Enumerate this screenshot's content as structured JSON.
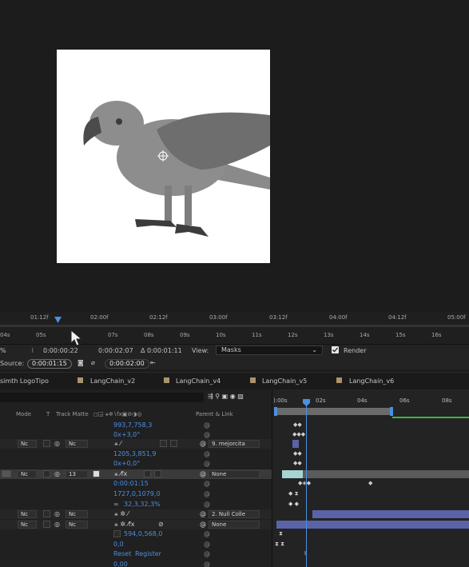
{
  "ruler": {
    "top_ticks": [
      "01:12f",
      "02:00f",
      "02:12f",
      "03:00f",
      "03:12f",
      "04:00f",
      "04:12f",
      "05:00f"
    ],
    "bottom_ticks": [
      "04s",
      "05s",
      "07s",
      "08s",
      "09s",
      "10s",
      "11s",
      "12s",
      "13s",
      "14s",
      "15s",
      "16s"
    ]
  },
  "footbar": {
    "percent_fragment": "%",
    "current_time": "0:00:00:22",
    "duration": "0:00:02:07",
    "delta": "Δ 0:00:01:11",
    "view_label": "View:",
    "view_value": "Masks",
    "render_label": "Render",
    "source_label": "Source:",
    "source_time": "0:00:01:15",
    "source_end": "0:00:02:00"
  },
  "tabs": [
    "simth LogoTipo",
    "LangChain_v2",
    "LangChain_v4",
    "LangChain_v5",
    "LangChain_v6"
  ],
  "columns": {
    "mode": "Mode",
    "t": "T",
    "track_matte": "Track Matte",
    "parent": "Parent & Link"
  },
  "timeline_labels": [
    "):00s",
    "02s",
    "04s",
    "06s",
    "08s"
  ],
  "rows": [
    {
      "value": "993,7,758,3"
    },
    {
      "value": "0x+3,0°"
    },
    {
      "mode": "Nc",
      "matte": "Nc",
      "parent": "9. mejorcita"
    },
    {
      "value": "1205,3,851,9"
    },
    {
      "value": "0x+0,0°"
    },
    {
      "mode": "Nc",
      "matte": "13",
      "parent": "None"
    },
    {
      "value": "0:00:01:15"
    },
    {
      "value": "1727,0,1079,0"
    },
    {
      "value": "32,3,32,3%"
    },
    {
      "mode": "Nc",
      "matte": "Nc",
      "parent": "2. Null Colle"
    },
    {
      "mode": "Nc",
      "matte": "Nc",
      "parent": "None"
    },
    {
      "value": "594,0,568,0"
    },
    {
      "value": "0,0"
    },
    {
      "reset": "Reset",
      "register": "Register"
    },
    {
      "value": "0,00"
    }
  ],
  "colors": {
    "accent": "#4a90e2",
    "label_tan": "#a9946c",
    "workarea_green": "#39b54a",
    "layer_bar_blue": "#5a63a8"
  },
  "icons": [
    "playhead-icon",
    "camera-icon",
    "mask-icon",
    "spiral-link-icon",
    "dropdown-arrow-icon",
    "checkbox-icon"
  ]
}
